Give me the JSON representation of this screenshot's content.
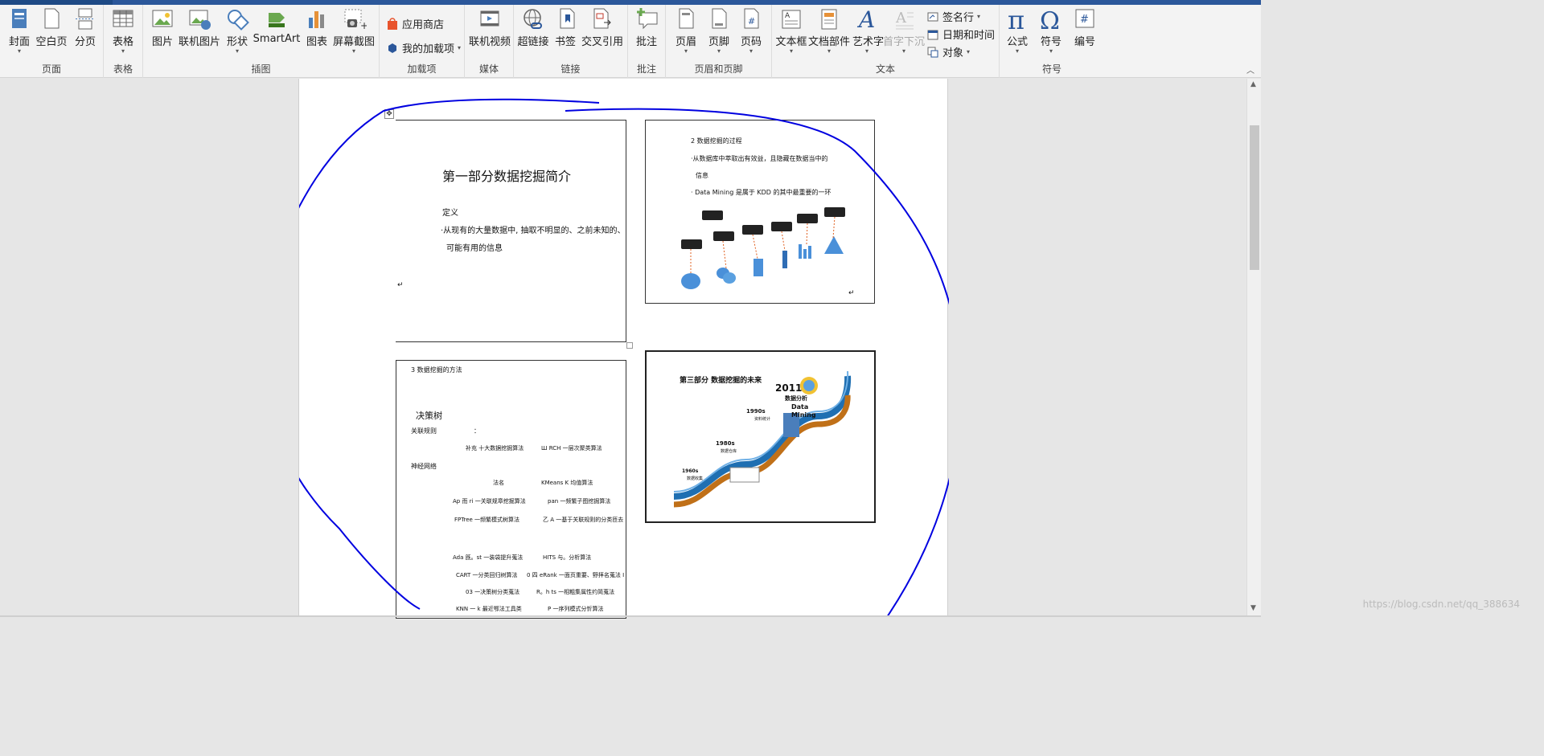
{
  "ribbon": {
    "groups": {
      "pages": "页面",
      "tables": "表格",
      "illustrations": "插图",
      "addins": "加载项",
      "media": "媒体",
      "links": "链接",
      "comments": "批注",
      "header_footer": "页眉和页脚",
      "text": "文本",
      "symbols": "符号"
    },
    "buttons": {
      "cover": "封面",
      "blank_page": "空白页",
      "page_break": "分页",
      "table": "表格",
      "picture": "图片",
      "online_picture": "联机图片",
      "shapes": "形状",
      "smartart": "SmartArt",
      "chart": "图表",
      "screenshot": "屏幕截图",
      "store": "应用商店",
      "my_addins": "我的加载项",
      "online_video": "联机视频",
      "hyperlink": "超链接",
      "bookmark": "书签",
      "cross_reference": "交叉引用",
      "comment": "批注",
      "header": "页眉",
      "footer": "页脚",
      "page_number": "页码",
      "text_box": "文本框",
      "quick_parts": "文档部件",
      "wordart": "艺术字",
      "drop_cap": "首字下沉",
      "signature_line": "签名行",
      "date_time": "日期和时间",
      "object": "对象",
      "equation": "公式",
      "symbol": "符号",
      "numbering": "编号"
    }
  },
  "document": {
    "slide1": {
      "title": "第一部分数据挖掘简介",
      "def": "定义",
      "line1": "·从现有的大量数据中, 抽取不明显的、之前未知的、",
      "line2": "可能有用的信息"
    },
    "slide2": {
      "title": "2 数据挖掘的过程",
      "line1": "·从数据库中萃取出有效益，且隐藏在数据当中的",
      "line2": "信息",
      "line3": "· Data Mining 是属于 KDD 的其中最重要的一环"
    },
    "slide3": {
      "title": "3 数据挖掘的方法",
      "dtree": "决策树",
      "assoc": "关联规则",
      "colon": "：",
      "r1a": "补充  十大数据挖掘算法",
      "r1b": "Ш RCH 一层次聚类算法",
      "nn": "神经网络",
      "r2a": "法名",
      "r2b": "KMeans K 均值算法",
      "r3a": "Ap 而 ri 一关联规章挖掘算法",
      "r3b": "pan 一频繁子图挖掘算法",
      "r4a": "FPTree 一频繁模式树算法",
      "r4b": "乙 A 一基于关联规则的分类匝去",
      "r5a": "Ada 旣。st 一装袋提升蒐法",
      "r5b": "HITS 与。分析算法",
      "r6a": "CART 一分类回归树算法",
      "r6b": "0 四 eRank 一面页重要、野拝名蒐法 I",
      "r7a": "03 一决策树分类蒐法",
      "r7b": "R。h ts 一相粗集属性约简蒐法",
      "r8a": "KNN 一 k 最近鄂法工具类",
      "r8b": "P 一序列模式分忻算法"
    },
    "slide4": {
      "title": "第三部分   数据挖掘的未来",
      "y2011": "2011",
      "a2011": "数据分析",
      "dm": "Data",
      "dm2": "Mining",
      "y1990": "1990s",
      "a1990": "资料统计",
      "y1980": "1980s",
      "a1980": "数据仓库",
      "y1960": "1960s",
      "a1960": "数据收集"
    }
  },
  "watermark": "https://blog.csdn.net/qq_388634"
}
